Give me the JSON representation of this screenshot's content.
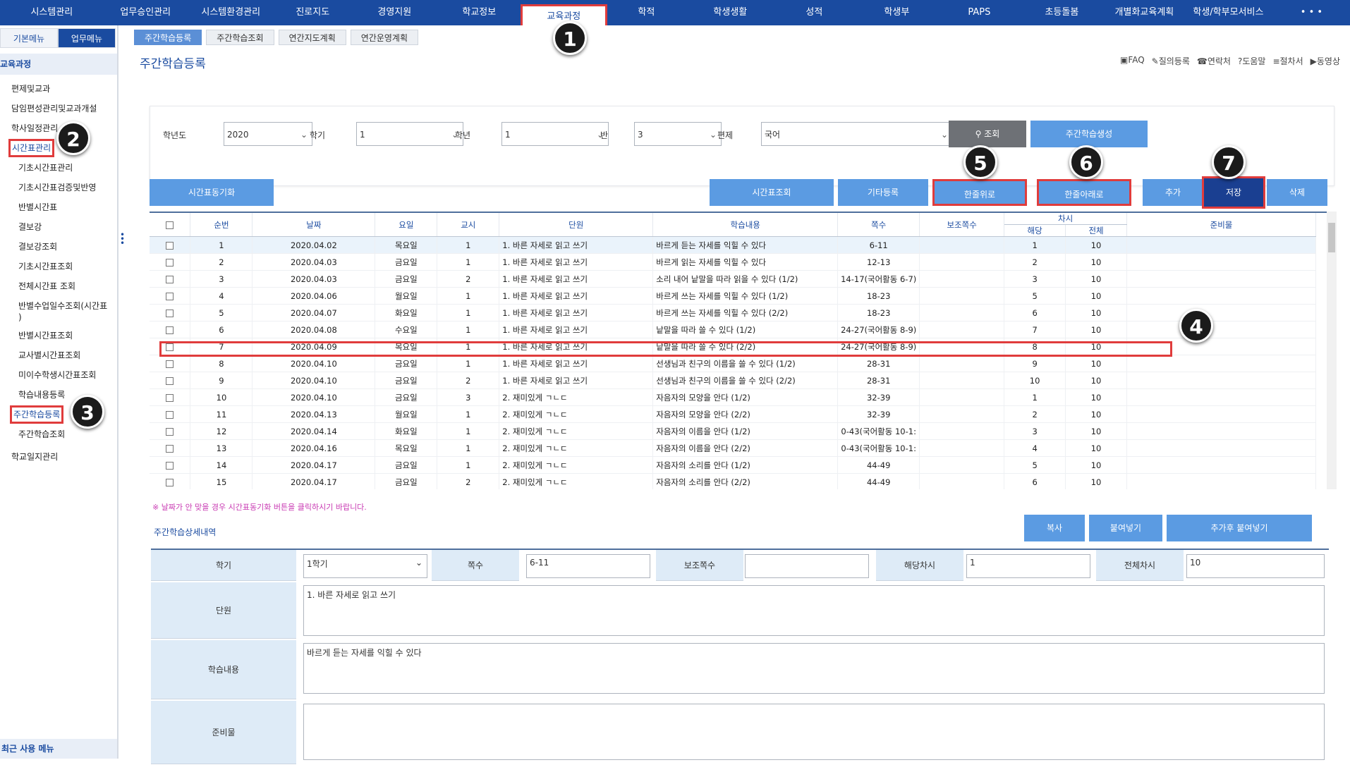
{
  "topnav": {
    "items": [
      "시스템관리",
      "업무승인관리",
      "시스템환경관리",
      "진로지도",
      "경영지원",
      "학교정보",
      "교육과정",
      "학적",
      "학생생활",
      "성적",
      "학생부",
      "PAPS",
      "초등돌봄",
      "개별화교육계획",
      "학생/학부모서비스",
      "• • •"
    ]
  },
  "sidebar": {
    "tabs": [
      "기본메뉴",
      "업무메뉴"
    ],
    "title": "교육과정",
    "items": [
      "편제및교과",
      "담임편성관리및교과개설",
      "학사일정관리",
      "시간표관리"
    ],
    "subitems": [
      "기초시간표관리",
      "기초시간표검증및반영",
      "반별시간표",
      "결보강",
      "결보강조회",
      "기초시간표조회",
      "전체시간표 조회",
      "반별수업일수조회(시간표",
      "반별시간표조회",
      "교사별시간표조회",
      "미이수학생시간표조회",
      "학습내용등록",
      "주간학습등록",
      "주간학습조회"
    ],
    "subitem_wrap": ")",
    "bottom_item": "학교일지관리",
    "recent": "최근 사용 메뉴"
  },
  "subtabs": [
    "주간학습등록",
    "주간학습조회",
    "연간지도계획",
    "연간운영계획"
  ],
  "page_title": "주간학습등록",
  "help_links": [
    "FAQ",
    "질의등록",
    "연락처",
    "도움말",
    "절차서",
    "동영상"
  ],
  "filter": {
    "labels": [
      "학년도",
      "학기",
      "학년",
      "반",
      "편제"
    ],
    "values": [
      "2020",
      "1",
      "1",
      "3",
      "국어"
    ],
    "search_label": "조회",
    "generate_label": "주간학습생성"
  },
  "actions": {
    "sync": "시간표동기화",
    "timetable": "시간표조회",
    "other": "기타등록",
    "up": "한줄위로",
    "down": "한줄아래로",
    "add": "추가",
    "save": "저장",
    "delete": "삭제"
  },
  "grid": {
    "headers": [
      "순번",
      "날짜",
      "요일",
      "교시",
      "단원",
      "학습내용",
      "쪽수",
      "보조쪽수",
      "차시",
      "준비물"
    ],
    "subheaders": [
      "해당",
      "전체"
    ],
    "rows": [
      [
        "1",
        "2020.04.02",
        "목요일",
        "1",
        "1. 바른 자세로 읽고 쓰기",
        "바르게 듣는 자세를 익힐 수 있다",
        "6-11",
        "",
        "1",
        "10"
      ],
      [
        "2",
        "2020.04.03",
        "금요일",
        "1",
        "1. 바른 자세로 읽고 쓰기",
        "바르게 읽는 자세를 익힐 수 있다",
        "12-13",
        "",
        "2",
        "10"
      ],
      [
        "3",
        "2020.04.03",
        "금요일",
        "2",
        "1. 바른 자세로 읽고 쓰기",
        "소리 내어 낱말을 따라 읽을 수 있다 (1/2)",
        "14-17(국어활동 6-7)",
        "",
        "3",
        "10"
      ],
      [
        "4",
        "2020.04.06",
        "월요일",
        "1",
        "1. 바른 자세로 읽고 쓰기",
        "바르게 쓰는 자세를 익힐 수 있다 (1/2)",
        "18-23",
        "",
        "5",
        "10"
      ],
      [
        "5",
        "2020.04.07",
        "화요일",
        "1",
        "1. 바른 자세로 읽고 쓰기",
        "바르게 쓰는 자세를 익힐 수 있다 (2/2)",
        "18-23",
        "",
        "6",
        "10"
      ],
      [
        "6",
        "2020.04.08",
        "수요일",
        "1",
        "1. 바른 자세로 읽고 쓰기",
        "낱말을 따라 쓸 수 있다 (1/2)",
        "24-27(국어활동 8-9)",
        "",
        "7",
        "10"
      ],
      [
        "7",
        "2020.04.09",
        "목요일",
        "1",
        "1. 바른 자세로 읽고 쓰기",
        "낱말을 따라 쓸 수 있다 (2/2)",
        "24-27(국어활동 8-9)",
        "",
        "8",
        "10"
      ],
      [
        "8",
        "2020.04.10",
        "금요일",
        "1",
        "1. 바른 자세로 읽고 쓰기",
        "선생님과 친구의 이름을 쓸 수 있다 (1/2)",
        "28-31",
        "",
        "9",
        "10"
      ],
      [
        "9",
        "2020.04.10",
        "금요일",
        "2",
        "1. 바른 자세로 읽고 쓰기",
        "선생님과 친구의 이름을 쓸 수 있다 (2/2)",
        "28-31",
        "",
        "10",
        "10"
      ],
      [
        "10",
        "2020.04.10",
        "금요일",
        "3",
        "2. 재미있게 ㄱㄴㄷ",
        "자음자의 모양을 안다 (1/2)",
        "32-39",
        "",
        "1",
        "10"
      ],
      [
        "11",
        "2020.04.13",
        "월요일",
        "1",
        "2. 재미있게 ㄱㄴㄷ",
        "자음자의 모양을 안다 (2/2)",
        "32-39",
        "",
        "2",
        "10"
      ],
      [
        "12",
        "2020.04.14",
        "화요일",
        "1",
        "2. 재미있게 ㄱㄴㄷ",
        "자음자의 이름을 안다 (1/2)",
        "0-43(국어활동 10-1:",
        "",
        "3",
        "10"
      ],
      [
        "13",
        "2020.04.16",
        "목요일",
        "1",
        "2. 재미있게 ㄱㄴㄷ",
        "자음자의 이름을 안다 (2/2)",
        "0-43(국어활동 10-1:",
        "",
        "4",
        "10"
      ],
      [
        "14",
        "2020.04.17",
        "금요일",
        "1",
        "2. 재미있게 ㄱㄴㄷ",
        "자음자의 소리를 안다 (1/2)",
        "44-49",
        "",
        "5",
        "10"
      ],
      [
        "15",
        "2020.04.17",
        "금요일",
        "2",
        "2. 재미있게 ㄱㄴㄷ",
        "자음자의 소리를 안다 (2/2)",
        "44-49",
        "",
        "6",
        "10"
      ]
    ]
  },
  "note": "※ 날짜가 안 맞을 경우 시간표동기화 버튼을 클릭하시기 바랍니다.",
  "detail": {
    "title": "주간학습상세내역",
    "copy": "복사",
    "paste": "붙여넣기",
    "add_paste": "추가후 붙여넣기",
    "labels": [
      "학기",
      "쪽수",
      "보조쪽수",
      "해당차시",
      "전체차시",
      "단원",
      "학습내용",
      "준비물"
    ],
    "semester": "1학기",
    "pages": "6-11",
    "sub_pages": "",
    "lesson": "1",
    "total": "10",
    "unit": "1. 바른 자세로 읽고 쓰기",
    "content": "바르게 듣는 자세를 익힐 수 있다",
    "materials": ""
  },
  "badges": [
    "1",
    "2",
    "3",
    "4",
    "5",
    "6",
    "7"
  ],
  "colors": {
    "primary": "#1a4ba0",
    "button": "#5b9be2",
    "annotation": "#e03c3c"
  }
}
